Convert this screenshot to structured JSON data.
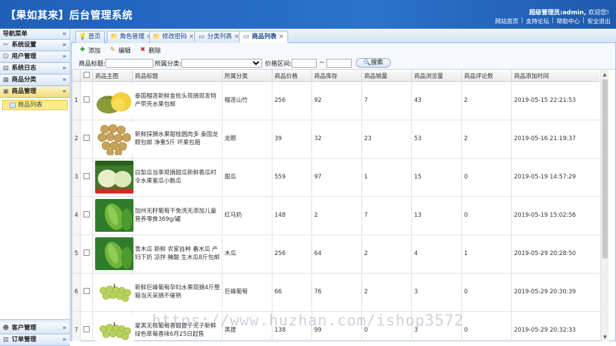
{
  "header": {
    "title": "【果如其来】后台管理系统",
    "welcome_user": "超级管理员:admin,",
    "welcome_text": " 欢迎您!",
    "links": [
      "网站首页",
      "支持论坛",
      "帮助中心",
      "安全退出"
    ]
  },
  "sidebar": {
    "title": "导航菜单",
    "groups": [
      {
        "label": "系统设置"
      },
      {
        "label": "用户管理"
      },
      {
        "label": "系统日志"
      },
      {
        "label": "商品分类"
      },
      {
        "label": "商品管理"
      }
    ],
    "active_item": "商品列表",
    "bottom_groups": [
      {
        "label": "客户管理"
      },
      {
        "label": "订单管理"
      }
    ]
  },
  "tabs": [
    {
      "label": "首页"
    },
    {
      "label": "角色管理"
    },
    {
      "label": "修改密码"
    },
    {
      "label": "分类列表"
    },
    {
      "label": "商品列表"
    }
  ],
  "toolbar": {
    "add": "添加",
    "edit": "编辑",
    "delete": "删除"
  },
  "search": {
    "title_label": "商品标题:",
    "category_label": "所属分类:",
    "price_label": "价格区间:",
    "tilde": "~",
    "button": "搜索"
  },
  "grid": {
    "columns": [
      "商品主图",
      "商品标题",
      "所属分类",
      "商品价格",
      "商品库存",
      "商品销量",
      "商品浏览量",
      "商品评论数",
      "商品添加时间"
    ],
    "rows": [
      {
        "n": "1",
        "title": "泰国榴莲新鲜金枕头现摘现发特产带壳水果包邮",
        "cat": "榴莲山竹",
        "price": "256",
        "stock": "92",
        "sales": "7",
        "views": "43",
        "comments": "2",
        "time": "2019-05-15 22:21:53",
        "img": "durian"
      },
      {
        "n": "2",
        "title": "新鲜採摘水果甜桂圆肉多 泰国龙眼包邮 净重5斤 坏果包赔",
        "cat": "龙眼",
        "price": "39",
        "stock": "32",
        "sales": "23",
        "views": "53",
        "comments": "2",
        "time": "2019-05-16 21:19:37",
        "img": "longan"
      },
      {
        "n": "3",
        "title": "白梨瓜当季现摘甜瓜新鲜香瓜时令水果蜜瓜小脆瓜",
        "cat": "甜瓜",
        "price": "559",
        "stock": "97",
        "sales": "1",
        "views": "15",
        "comments": "0",
        "time": "2019-05-19 14:57:29",
        "img": "melon"
      },
      {
        "n": "4",
        "title": "加州无籽葡萄干免洗无添加儿童营养零食369g/罐",
        "cat": "红马奶",
        "price": "148",
        "stock": "2",
        "sales": "7",
        "views": "13",
        "comments": "0",
        "time": "2019-05-19 15:02:56",
        "img": "papaya"
      },
      {
        "n": "5",
        "title": "青木瓜 新鲜 农家自种 番木瓜 产妇下奶 凉拌 腌酸 生木瓜8斤包邮",
        "cat": "木瓜",
        "price": "256",
        "stock": "64",
        "sales": "2",
        "views": "4",
        "comments": "1",
        "time": "2019-05-29 20:28:50",
        "img": "papaya"
      },
      {
        "n": "6",
        "title": "新鲜巨峰葡萄孕妇水果现摘4斤整箱当天采摘不催熟",
        "cat": "巨峰葡萄",
        "price": "66",
        "stock": "76",
        "sales": "2",
        "views": "3",
        "comments": "0",
        "time": "2019-05-29 20:30:39",
        "img": "grape"
      },
      {
        "n": "7",
        "title": "夏黑无核葡萄香甜提子无子新鲜绿色草莓香味6月25日起售",
        "cat": "黑提",
        "price": "138",
        "stock": "99",
        "sales": "0",
        "views": "3",
        "comments": "0",
        "time": "2019-05-29 20:32:33",
        "img": "grape"
      }
    ]
  },
  "watermark": "https://www.huzhan.com/ishop3572",
  "colors": {
    "header": "#2a73cc",
    "border": "#99bbe8",
    "active_item": "#fbec88"
  }
}
